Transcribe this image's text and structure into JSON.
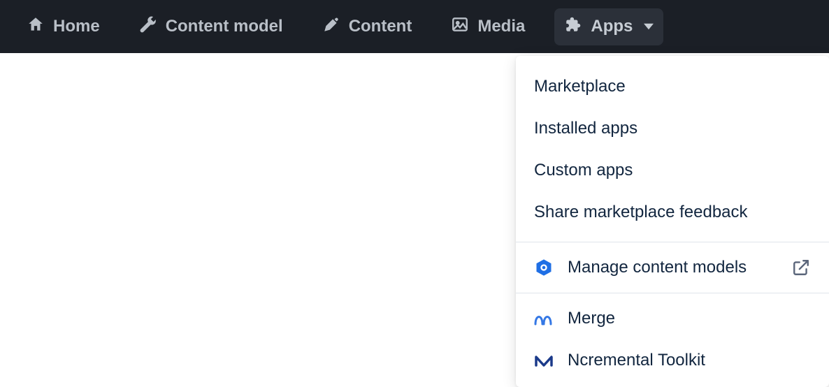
{
  "nav": {
    "home": "Home",
    "content_model": "Content model",
    "content": "Content",
    "media": "Media",
    "apps": "Apps"
  },
  "dropdown": {
    "basic": {
      "marketplace": "Marketplace",
      "installed": "Installed apps",
      "custom": "Custom apps",
      "feedback": "Share marketplace feedback"
    },
    "manage_models": "Manage content models",
    "apps_list": {
      "merge": "Merge",
      "ncremental": "Ncremental Toolkit"
    }
  }
}
